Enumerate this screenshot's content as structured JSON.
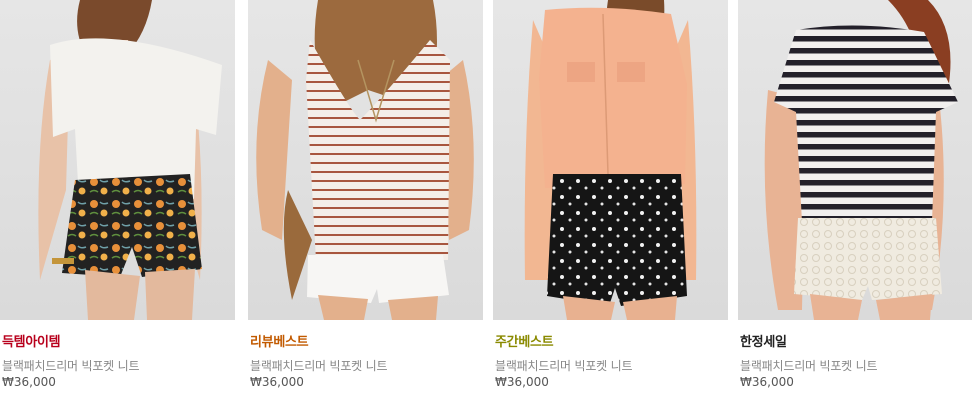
{
  "products": [
    {
      "tag": "득템아이템",
      "tag_color": "#b8001c",
      "name": "블랙패치드리머 빅포켓 니트",
      "price": "₩36,000",
      "photo": "model-white-knit-floral-shorts"
    },
    {
      "tag": "리뷰베스트",
      "tag_color": "#c25a00",
      "name": "블랙패치드리머 빅포켓 니트",
      "price": "₩36,000",
      "photo": "model-striped-tank-white-shorts"
    },
    {
      "tag": "주간베스트",
      "tag_color": "#8a8a00",
      "name": "블랙패치드리머 빅포켓 니트",
      "price": "₩36,000",
      "photo": "model-peach-blouse-black-shorts"
    },
    {
      "tag": "한정세일",
      "tag_color": "#222222",
      "name": "블랙패치드리머 빅포켓 니트",
      "price": "₩36,000",
      "photo": "model-striped-tee-lace-shorts"
    }
  ]
}
